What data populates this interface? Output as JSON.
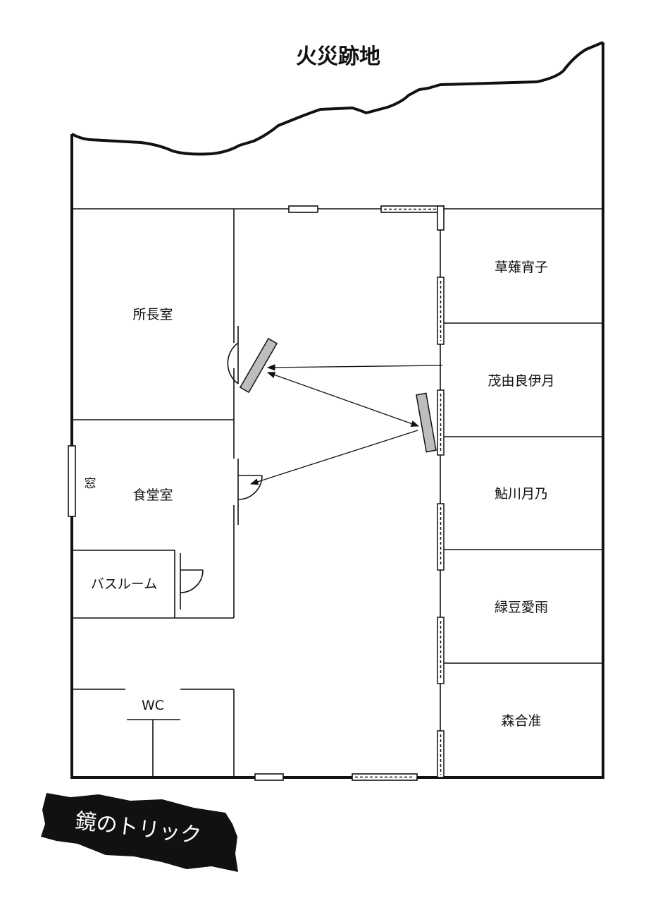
{
  "title": "火災跡地",
  "rooms": {
    "director": "所長室",
    "dining": "食堂室",
    "bathroom": "バスルーム",
    "wc": "WC",
    "window": "窓",
    "guest1": "草薙宵子",
    "guest2": "茂由良伊月",
    "guest3": "鮎川月乃",
    "guest4": "緑豆愛雨",
    "guest5": "森合准"
  },
  "banner": "鏡のトリック",
  "colors": {
    "line": "#111111",
    "mirror": "#bdbdbd",
    "banner_bg": "#111111",
    "banner_text": "#ffffff"
  }
}
